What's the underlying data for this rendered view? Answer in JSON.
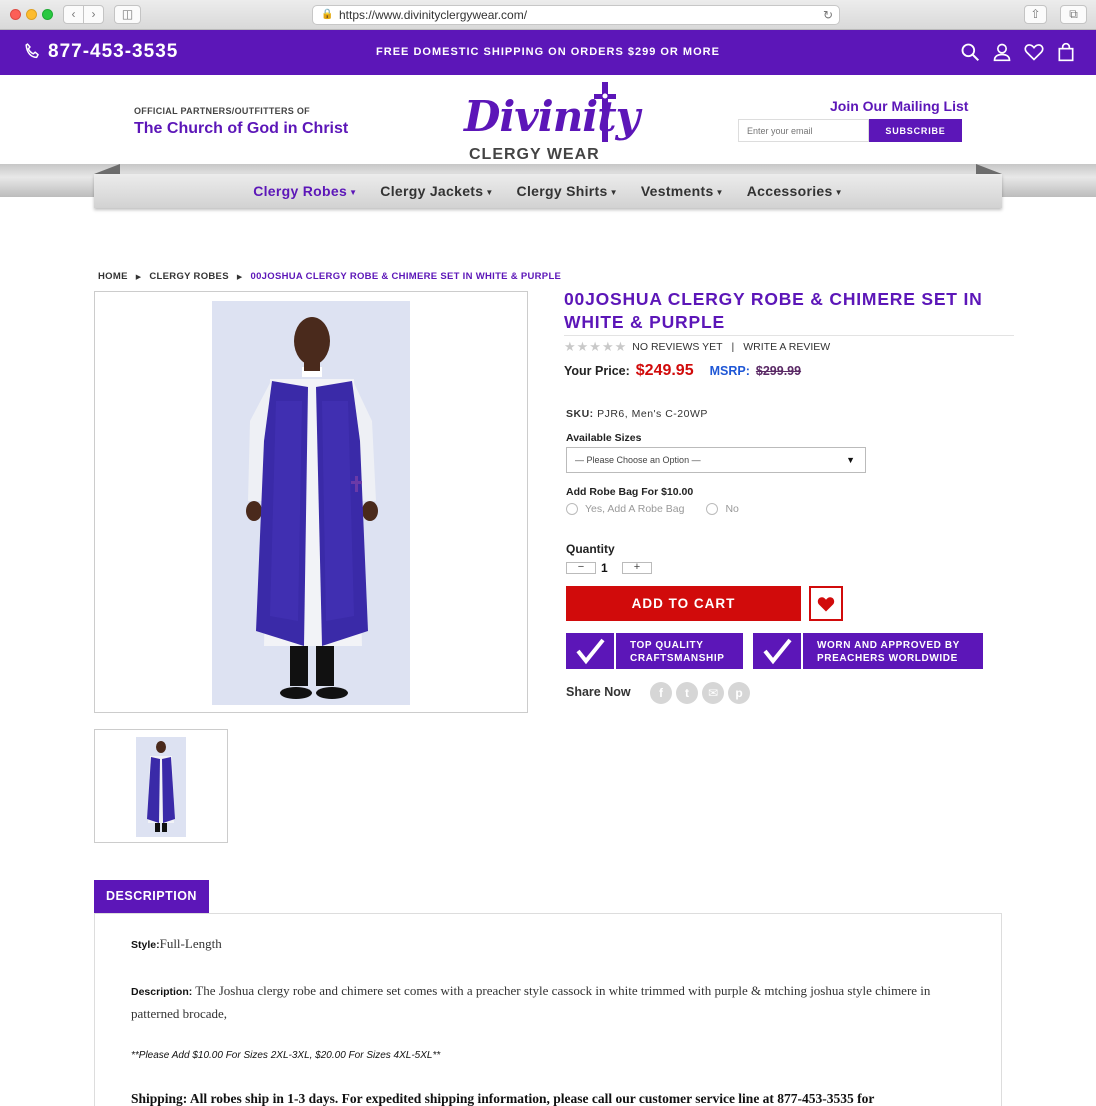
{
  "browser": {
    "url": "https://www.divinityclergywear.com/",
    "icons": [
      "back-icon",
      "forward-icon",
      "sidebar-icon",
      "lock-icon",
      "reload-icon",
      "share-icon",
      "tabs-icon"
    ]
  },
  "topbar": {
    "phone": "877-453-3535",
    "shipping_message": "FREE DOMESTIC SHIPPING ON ORDERS $299 OR MORE",
    "icons": [
      "search-icon",
      "account-icon",
      "wishlist-icon",
      "cart-icon"
    ],
    "color": "#5c16b8"
  },
  "header": {
    "partners_small": "OFFICIAL PARTNERS/OUTFITTERS OF",
    "partners_big": "The Church of God in Christ",
    "logo_script": "Divinity",
    "logo_sub": "CLERGY WEAR",
    "mailing_title": "Join Our Mailing List",
    "email_placeholder": "Enter your email",
    "subscribe_label": "SUBSCRIBE"
  },
  "nav": {
    "items": [
      {
        "label": "Clergy Robes",
        "active": true
      },
      {
        "label": "Clergy Jackets",
        "active": false
      },
      {
        "label": "Clergy Shirts",
        "active": false
      },
      {
        "label": "Vestments",
        "active": false
      },
      {
        "label": "Accessories",
        "active": false
      }
    ]
  },
  "breadcrumb": [
    "HOME",
    "CLERGY ROBES",
    "00JOSHUA CLERGY ROBE & CHIMERE SET IN WHITE & PURPLE"
  ],
  "product": {
    "title": "00JOSHUA CLERGY ROBE & CHIMERE SET IN WHITE & PURPLE",
    "stars": "★★★★★",
    "rating": 0,
    "reviews_text": "NO REVIEWS YET",
    "write_review": "WRITE A REVIEW",
    "price_label": "Your Price:",
    "price": "$249.95",
    "msrp_label": "MSRP:",
    "msrp": "$299.99",
    "sku_label": "SKU:",
    "sku": "PJR6, Men's C-20WP",
    "sizes_label": "Available Sizes",
    "size_selected": "— Please Choose an Option —",
    "bag_label": "Add Robe Bag For $10.00",
    "bag_options": [
      "Yes, Add A Robe Bag",
      "No"
    ],
    "quantity_label": "Quantity",
    "quantity": "1",
    "add_to_cart": "ADD TO CART",
    "badge1_line1": "TOP QUALITY",
    "badge1_line2": "CRAFTSMANSHIP",
    "badge2_line1": "WORN AND APPROVED BY",
    "badge2_line2": "PREACHERS WORLDWIDE",
    "share_label": "Share Now",
    "share_icons": [
      "facebook-icon",
      "twitter-icon",
      "email-icon",
      "pinterest-icon"
    ],
    "price_color": "#d10b0b",
    "msrp_color": "#1f57d6"
  },
  "description": {
    "tab_label": "DESCRIPTION",
    "style_label": "Style:",
    "style_value": "Full-Length",
    "desc_label": "Description:",
    "desc_text": " The Joshua clergy robe and chimere set comes with a preacher style cassock in white trimmed with purple & mtching joshua style chimere in patterned brocade,",
    "note": "**Please Add $10.00 For Sizes 2XL-3XL, $20.00 For Sizes 4XL-5XL**",
    "shipping": "Shipping: All robes ship in 1-3 days. For expedited shipping information, please call our customer service line at 877-453-3535 for"
  }
}
